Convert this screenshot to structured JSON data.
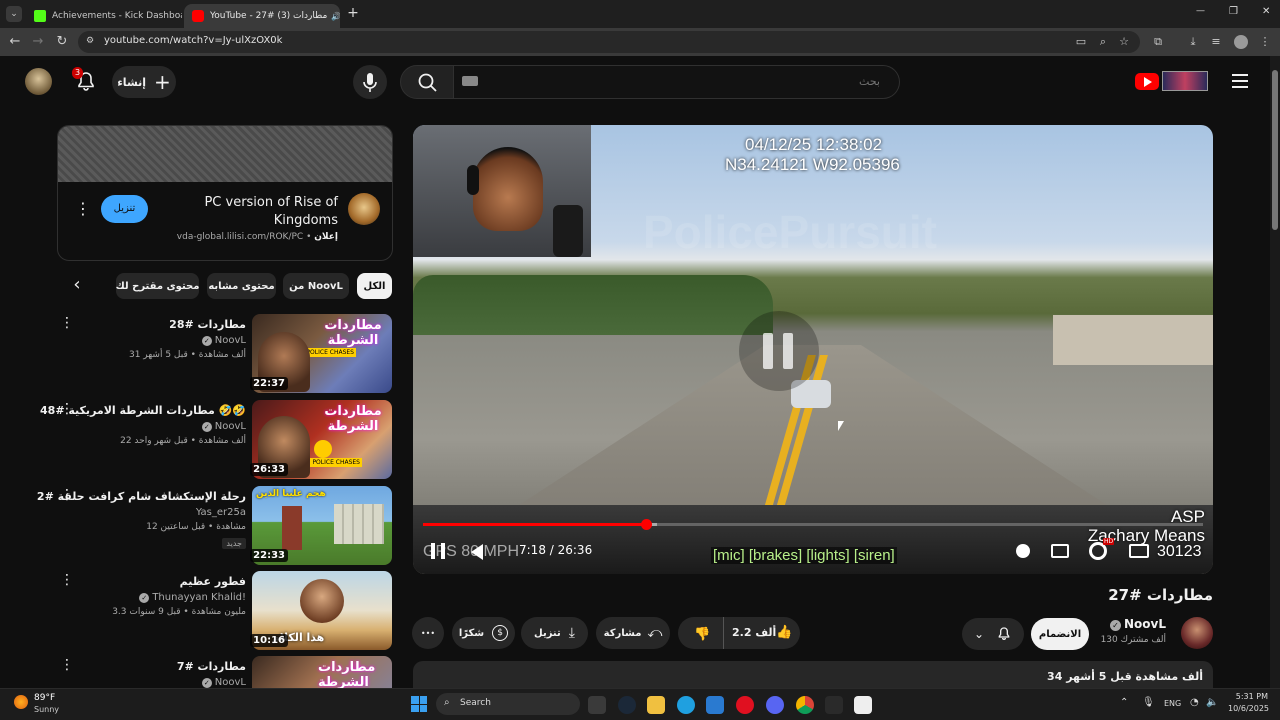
{
  "browser": {
    "tabs": [
      {
        "title": "Achievements - Kick Dashboard",
        "close": "✕"
      },
      {
        "title": "YouTube - 27# مطاردات (3)",
        "close": "✕"
      }
    ],
    "new_tab": "+",
    "url": "youtube.com/watch?v=Jy-ulXzOX0k",
    "window_controls": {
      "minimize": "—",
      "restore": "❐",
      "close": "✕"
    }
  },
  "header": {
    "notification_count": "3",
    "create_label": "إنشاء",
    "search_placeholder": "بحث",
    "menu_icon": "hamburger-icon"
  },
  "ad": {
    "title_line1": "PC version of Rise of",
    "title_line2": "Kingdoms",
    "sponsor_label": "إعلان",
    "url": "vda-global.lilisi.com/ROK/PC",
    "separator": "•",
    "cta": "تنزيل"
  },
  "chips": [
    "الكل",
    "من NoovL",
    "محتوى مشابه",
    "محتوى مقترح لك"
  ],
  "related": [
    {
      "title": "مطاردات #28",
      "channel": "NoovL",
      "meta": "31 ألف مشاهدة • قبل 5 أشهر",
      "duration": "22:37",
      "badge": "",
      "verified": true
    },
    {
      "title": "مطاردات الشرطة الامريكية #48 🤣🤣",
      "channel": "NoovL",
      "meta": "22 ألف مشاهدة • قبل شهر واحد",
      "duration": "26:33",
      "badge": "",
      "verified": true
    },
    {
      "title": "رحلة الإستكشاف شام كرافت حلقة #2",
      "channel": "Yas_er25a",
      "meta": "12 مشاهدة • قبل ساعتين",
      "duration": "22:33",
      "badge": "جديد",
      "verified": false
    },
    {
      "title": "فطور عظيم",
      "channel": "Thunayyan Khalid!",
      "meta": "3.3 مليون مشاهدة • قبل 9 سنوات",
      "duration": "10:16",
      "badge": "",
      "verified": true
    },
    {
      "title": "مطاردات #7",
      "channel": "NoovL",
      "meta": "",
      "duration": "",
      "badge": "",
      "verified": true
    }
  ],
  "thumb_texts": {
    "t1": "مطاردات الشرطة",
    "t2": "مطاردات الشرطة",
    "t3": "هجم علينا الذين",
    "t4": "هذا الكلام",
    "t5": "مطاردات الشرطة",
    "police": "POLICE CHASES"
  },
  "player": {
    "timestamp": "04/12/25 12:38:02",
    "gps": "N34.24121 W92.05396",
    "watermark": "PolicePursuit",
    "speed": "GPS 80 MPH",
    "time_display": "7:18 / 26:36",
    "captions": "[mic] [brakes] [lights] [siren]",
    "overlay_line1": "ASP",
    "overlay_line2": "Zachary Means",
    "overlay_line3": "30123",
    "progress_fraction": 0.286,
    "buffer_fraction": 0.3,
    "hd_badge": "HD"
  },
  "video": {
    "title": "مطاردات #27",
    "channel": "NoovL",
    "subscribers": "130 ألف مشترك",
    "join": "الانضمام",
    "likes": "2.2 ألف",
    "share": "مشاركة",
    "download": "تنزيل",
    "thanks": "شكرًا",
    "more": "•••",
    "description_meta": "34 ألف مشاهدة  قبل 5 أشهر"
  },
  "taskbar": {
    "weather_temp": "89°F",
    "weather_desc": "Sunny",
    "search_label": "Search",
    "lang": "ENG",
    "time": "5:31 PM",
    "date": "10/6/2025"
  },
  "colors": {
    "yt_red": "#ff0000",
    "progress_red": "#f00",
    "chip_bg": "#272727",
    "blue_cta": "#3ea6ff",
    "caption_green": "#b8f08a"
  }
}
